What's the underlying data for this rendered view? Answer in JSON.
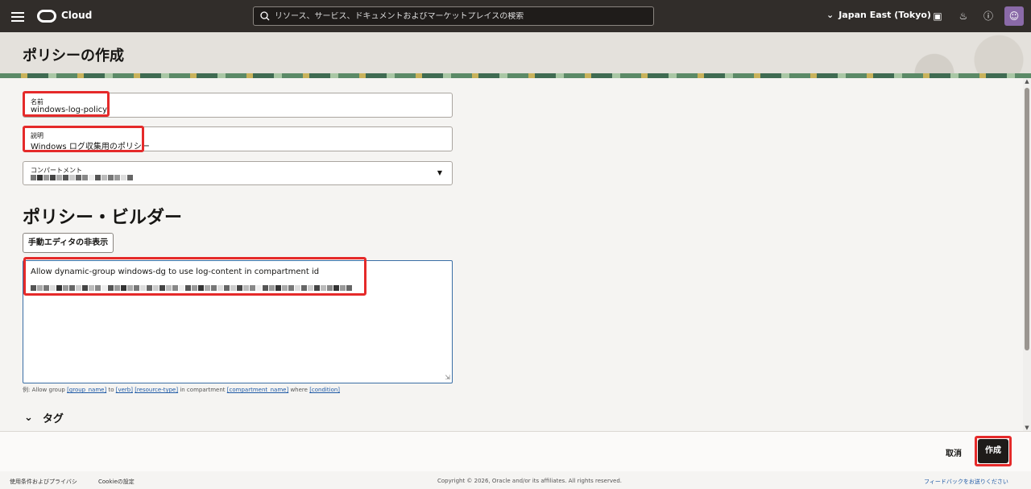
{
  "header": {
    "brand": "Cloud",
    "search_placeholder": "リソース、サービス、ドキュメントおよびマーケットプレイスの検索",
    "region": "Japan East (Tokyo)"
  },
  "page": {
    "title": "ポリシーの作成"
  },
  "form": {
    "name_label": "名前",
    "name_value": "windows-log-policy",
    "description_label": "説明",
    "description_value": "Windows ログ収集用のポリシー",
    "compartment_label": "コンパートメント"
  },
  "builder": {
    "title": "ポリシー・ビルダー",
    "toggle_button": "手動エディタの非表示",
    "statement": "Allow dynamic-group windows-dg to use log-content in compartment id",
    "hint_prefix": "例: Allow group",
    "hint_group": "[group_name]",
    "hint_to": "to",
    "hint_verb": "[verb]",
    "hint_resource": "[resource-type]",
    "hint_in": "in compartment",
    "hint_compartment": "[compartment_name]",
    "hint_where": "where",
    "hint_condition": "[condition]"
  },
  "tags": {
    "label": "タグ"
  },
  "actions": {
    "cancel": "取消",
    "create": "作成"
  },
  "footer": {
    "terms": "使用条件およびプライバシ",
    "cookie": "Cookieの設定",
    "copyright": "Copyright © 2026, Oracle and/or its affiliates. All rights reserved.",
    "feedback": "フィードバックをお送りください"
  },
  "colors": {
    "topbar": "#312d2a",
    "highlight": "#e52a2a",
    "primary_button": "#1e1b19",
    "link": "#1f5aa6"
  }
}
